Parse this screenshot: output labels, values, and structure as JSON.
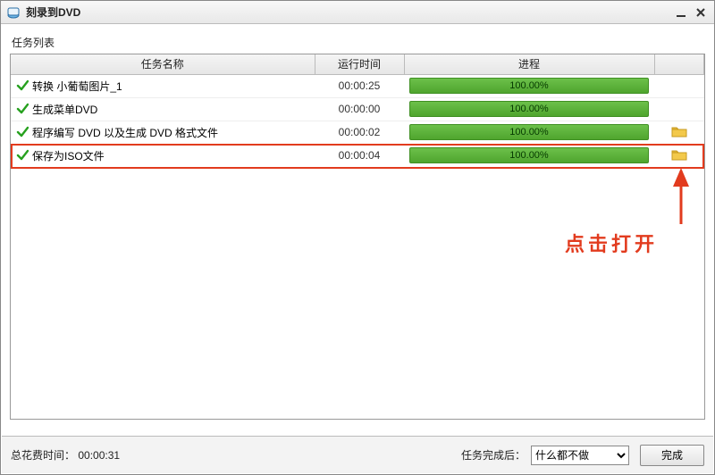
{
  "window": {
    "title": "刻录到DVD"
  },
  "section_label": "任务列表",
  "columns": {
    "name": "任务名称",
    "time": "运行时间",
    "progress": "进程"
  },
  "rows": [
    {
      "name": "转换 小葡萄图片_1",
      "time": "00:00:25",
      "progress": "100.00%",
      "folder": false
    },
    {
      "name": "生成菜单DVD",
      "time": "00:00:00",
      "progress": "100.00%",
      "folder": false
    },
    {
      "name": "程序编写 DVD 以及生成 DVD 格式文件",
      "time": "00:00:02",
      "progress": "100.00%",
      "folder": true
    },
    {
      "name": "保存为ISO文件",
      "time": "00:00:04",
      "progress": "100.00%",
      "folder": true
    }
  ],
  "footer": {
    "total_label": "总花费时间：",
    "total_value": "00:00:31",
    "after_label": "任务完成后：",
    "after_value": "什么都不做",
    "done_label": "完成"
  },
  "annotation": {
    "text": "点击打开"
  }
}
